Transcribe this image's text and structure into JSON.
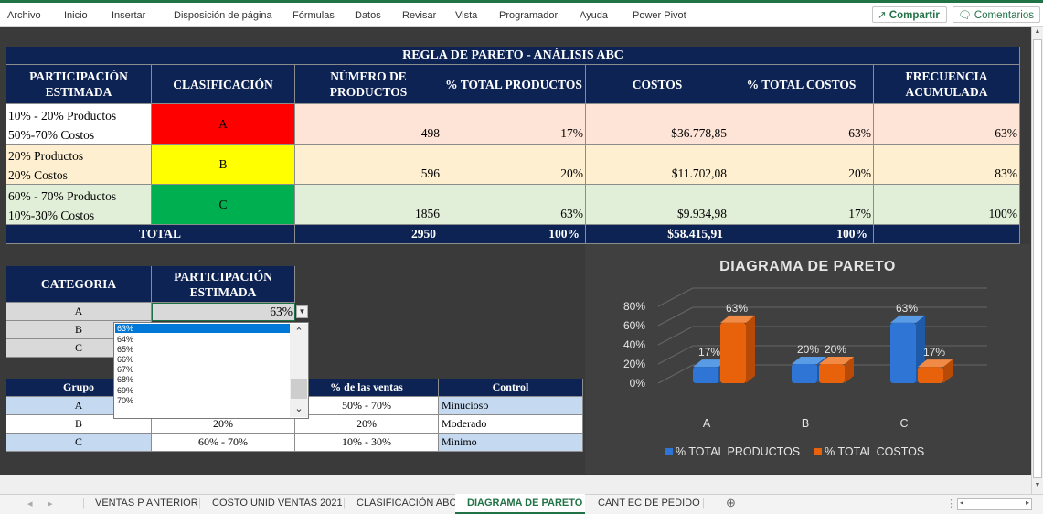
{
  "ribbon": {
    "tabs": [
      "Archivo",
      "Inicio",
      "Insertar",
      "Disposición de página",
      "Fórmulas",
      "Datos",
      "Revisar",
      "Vista",
      "Programador",
      "Ayuda",
      "Power Pivot"
    ],
    "share_label": "Compartir",
    "comments_label": "Comentarios"
  },
  "main_table": {
    "title": "REGLA DE PARETO - ANÁLISIS ABC",
    "headers": [
      "PARTICIPACIÓN ESTIMADA",
      "CLASIFICACIÓN",
      "NÚMERO DE PRODUCTOS",
      "% TOTAL PRODUCTOS",
      "COSTOS",
      "% TOTAL COSTOS",
      "FRECUENCIA ACUMULADA"
    ],
    "rows": [
      {
        "part_line1": "10% - 20% Productos",
        "part_line2": "50%-70% Costos",
        "class": "A",
        "num": "498",
        "pct_prod": "17%",
        "costos": "$36.778,85",
        "pct_costos": "63%",
        "freq": "63%"
      },
      {
        "part_line1": "20% Productos",
        "part_line2": "20% Costos",
        "class": "B",
        "num": "596",
        "pct_prod": "20%",
        "costos": "$11.702,08",
        "pct_costos": "20%",
        "freq": "83%"
      },
      {
        "part_line1": "60% - 70% Productos",
        "part_line2": "10%-30% Costos",
        "class": "C",
        "num": "1856",
        "pct_prod": "63%",
        "costos": "$9.934,98",
        "pct_costos": "17%",
        "freq": "100%"
      }
    ],
    "total": {
      "label": "TOTAL",
      "num": "2950",
      "pct_prod": "100%",
      "costos": "$58.415,91",
      "pct_costos": "100%"
    },
    "class_colors": {
      "A": "#ff0000",
      "B": "#ffff00",
      "C": "#00b050"
    }
  },
  "category_table": {
    "headers": [
      "CATEGORIA",
      "PARTICIPACIÓN ESTIMADA"
    ],
    "rows": [
      {
        "cat": "A",
        "val": "63%"
      },
      {
        "cat": "B",
        "val": ""
      },
      {
        "cat": "C",
        "val": ""
      }
    ]
  },
  "dropdown": {
    "options": [
      "63%",
      "64%",
      "65%",
      "66%",
      "67%",
      "68%",
      "69%",
      "70%"
    ],
    "selected": "63%"
  },
  "group_table": {
    "headers": [
      "Grupo",
      "",
      "% de las ventas",
      "Control"
    ],
    "rows": [
      {
        "grupo": "A",
        "c2": "",
        "ventas": "50% - 70%",
        "control": "Minucioso"
      },
      {
        "grupo": "B",
        "c2": "20%",
        "ventas": "20%",
        "control": "Moderado"
      },
      {
        "grupo": "C",
        "c2": "60% - 70%",
        "ventas": "10% - 30%",
        "control": "Minimo"
      }
    ]
  },
  "chart_data": {
    "type": "bar",
    "title": "DIAGRAMA DE PARETO",
    "categories": [
      "A",
      "B",
      "C"
    ],
    "series": [
      {
        "name": "% TOTAL PRODUCTOS",
        "values": [
          17,
          20,
          63
        ],
        "labels": [
          "17%",
          "20%",
          "63%"
        ],
        "color": "#2e75d6"
      },
      {
        "name": "% TOTAL COSTOS",
        "values": [
          63,
          20,
          17
        ],
        "labels": [
          "63%",
          "20%",
          "17%"
        ],
        "color": "#e8620c"
      }
    ],
    "ylim": [
      0,
      80
    ],
    "yticks": [
      "0%",
      "20%",
      "40%",
      "60%",
      "80%"
    ],
    "legend": "bottom",
    "style": "3d-clustered-column"
  },
  "sheet_tabs": {
    "tabs": [
      "VENTAS P ANTERIOR",
      "COSTO UNID VENTAS 2021",
      "CLASIFICACIÓN ABC",
      "DIAGRAMA DE PARETO",
      "CANT EC DE PEDIDO"
    ],
    "active": "DIAGRAMA DE PARETO"
  }
}
